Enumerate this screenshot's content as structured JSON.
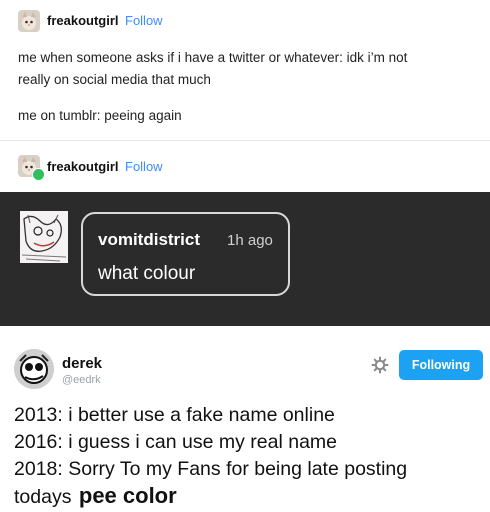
{
  "post1": {
    "username": "freakoutgirl",
    "follow_label": "Follow",
    "lines": [
      "me when someone asks if i have a twitter or whatever: idk i’m not",
      "really on social media that much",
      "me on tumblr: peeing again"
    ]
  },
  "post2": {
    "username": "freakoutgirl",
    "follow_label": "Follow",
    "comment": {
      "username": "vomitdistrict",
      "time": "1h ago",
      "text": "what colour"
    }
  },
  "tweet": {
    "name": "derek",
    "handle": "@eedrk",
    "follow_button": "Following",
    "lines": [
      "2013: i better use a fake name online",
      "2016: i guess i can use my real name",
      "2018: Sorry To my Fans for being late posting"
    ],
    "last_line_prefix": "todays",
    "last_line_bold": "pee color"
  },
  "colors": {
    "follow_link": "#3b8cff",
    "dark_panel": "#2b2b2b",
    "twitter_blue": "#1da1f2"
  }
}
